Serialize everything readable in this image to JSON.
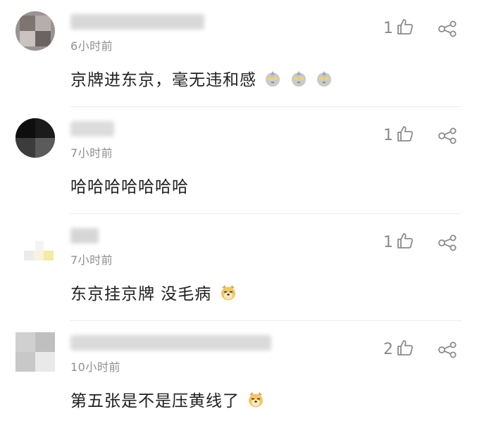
{
  "comments": [
    {
      "time": "6小时前",
      "text": "京牌进东京，毫无违和感",
      "likes": "1",
      "emoji": "ultraman-icon",
      "emoji_count": 3,
      "avatar_colors": [
        "#8a7f7c",
        "#b7b0ad",
        "#6d6563",
        "#cfc9c6"
      ],
      "name_blur_color": "#d2d2d2"
    },
    {
      "time": "7小时前",
      "text": "哈哈哈哈哈哈哈",
      "likes": "1",
      "emoji": "",
      "emoji_count": 0,
      "avatar_colors": [
        "#121212",
        "#2a2a2a",
        "#3b3b3b",
        "#5a5a5a"
      ],
      "name_blur_color": "#d6d6d6"
    },
    {
      "time": "7小时前",
      "text": "东京挂京牌 没毛病",
      "likes": "1",
      "emoji": "doge-icon",
      "emoji_count": 1,
      "avatar_colors": [
        "#f3f3f3",
        "#e9e9e9",
        "#f1e9c2",
        "#f0f0f0"
      ],
      "name_blur_color": "#d0d0d0"
    },
    {
      "time": "10小时前",
      "text": "第五张是不是压黄线了",
      "likes": "2",
      "emoji": "doge-icon",
      "emoji_count": 1,
      "avatar_colors": [
        "#c7c7c7",
        "#dadada",
        "#bdbdbd",
        "#e6e6e6"
      ],
      "name_blur_color": "#d4d4d4"
    }
  ]
}
